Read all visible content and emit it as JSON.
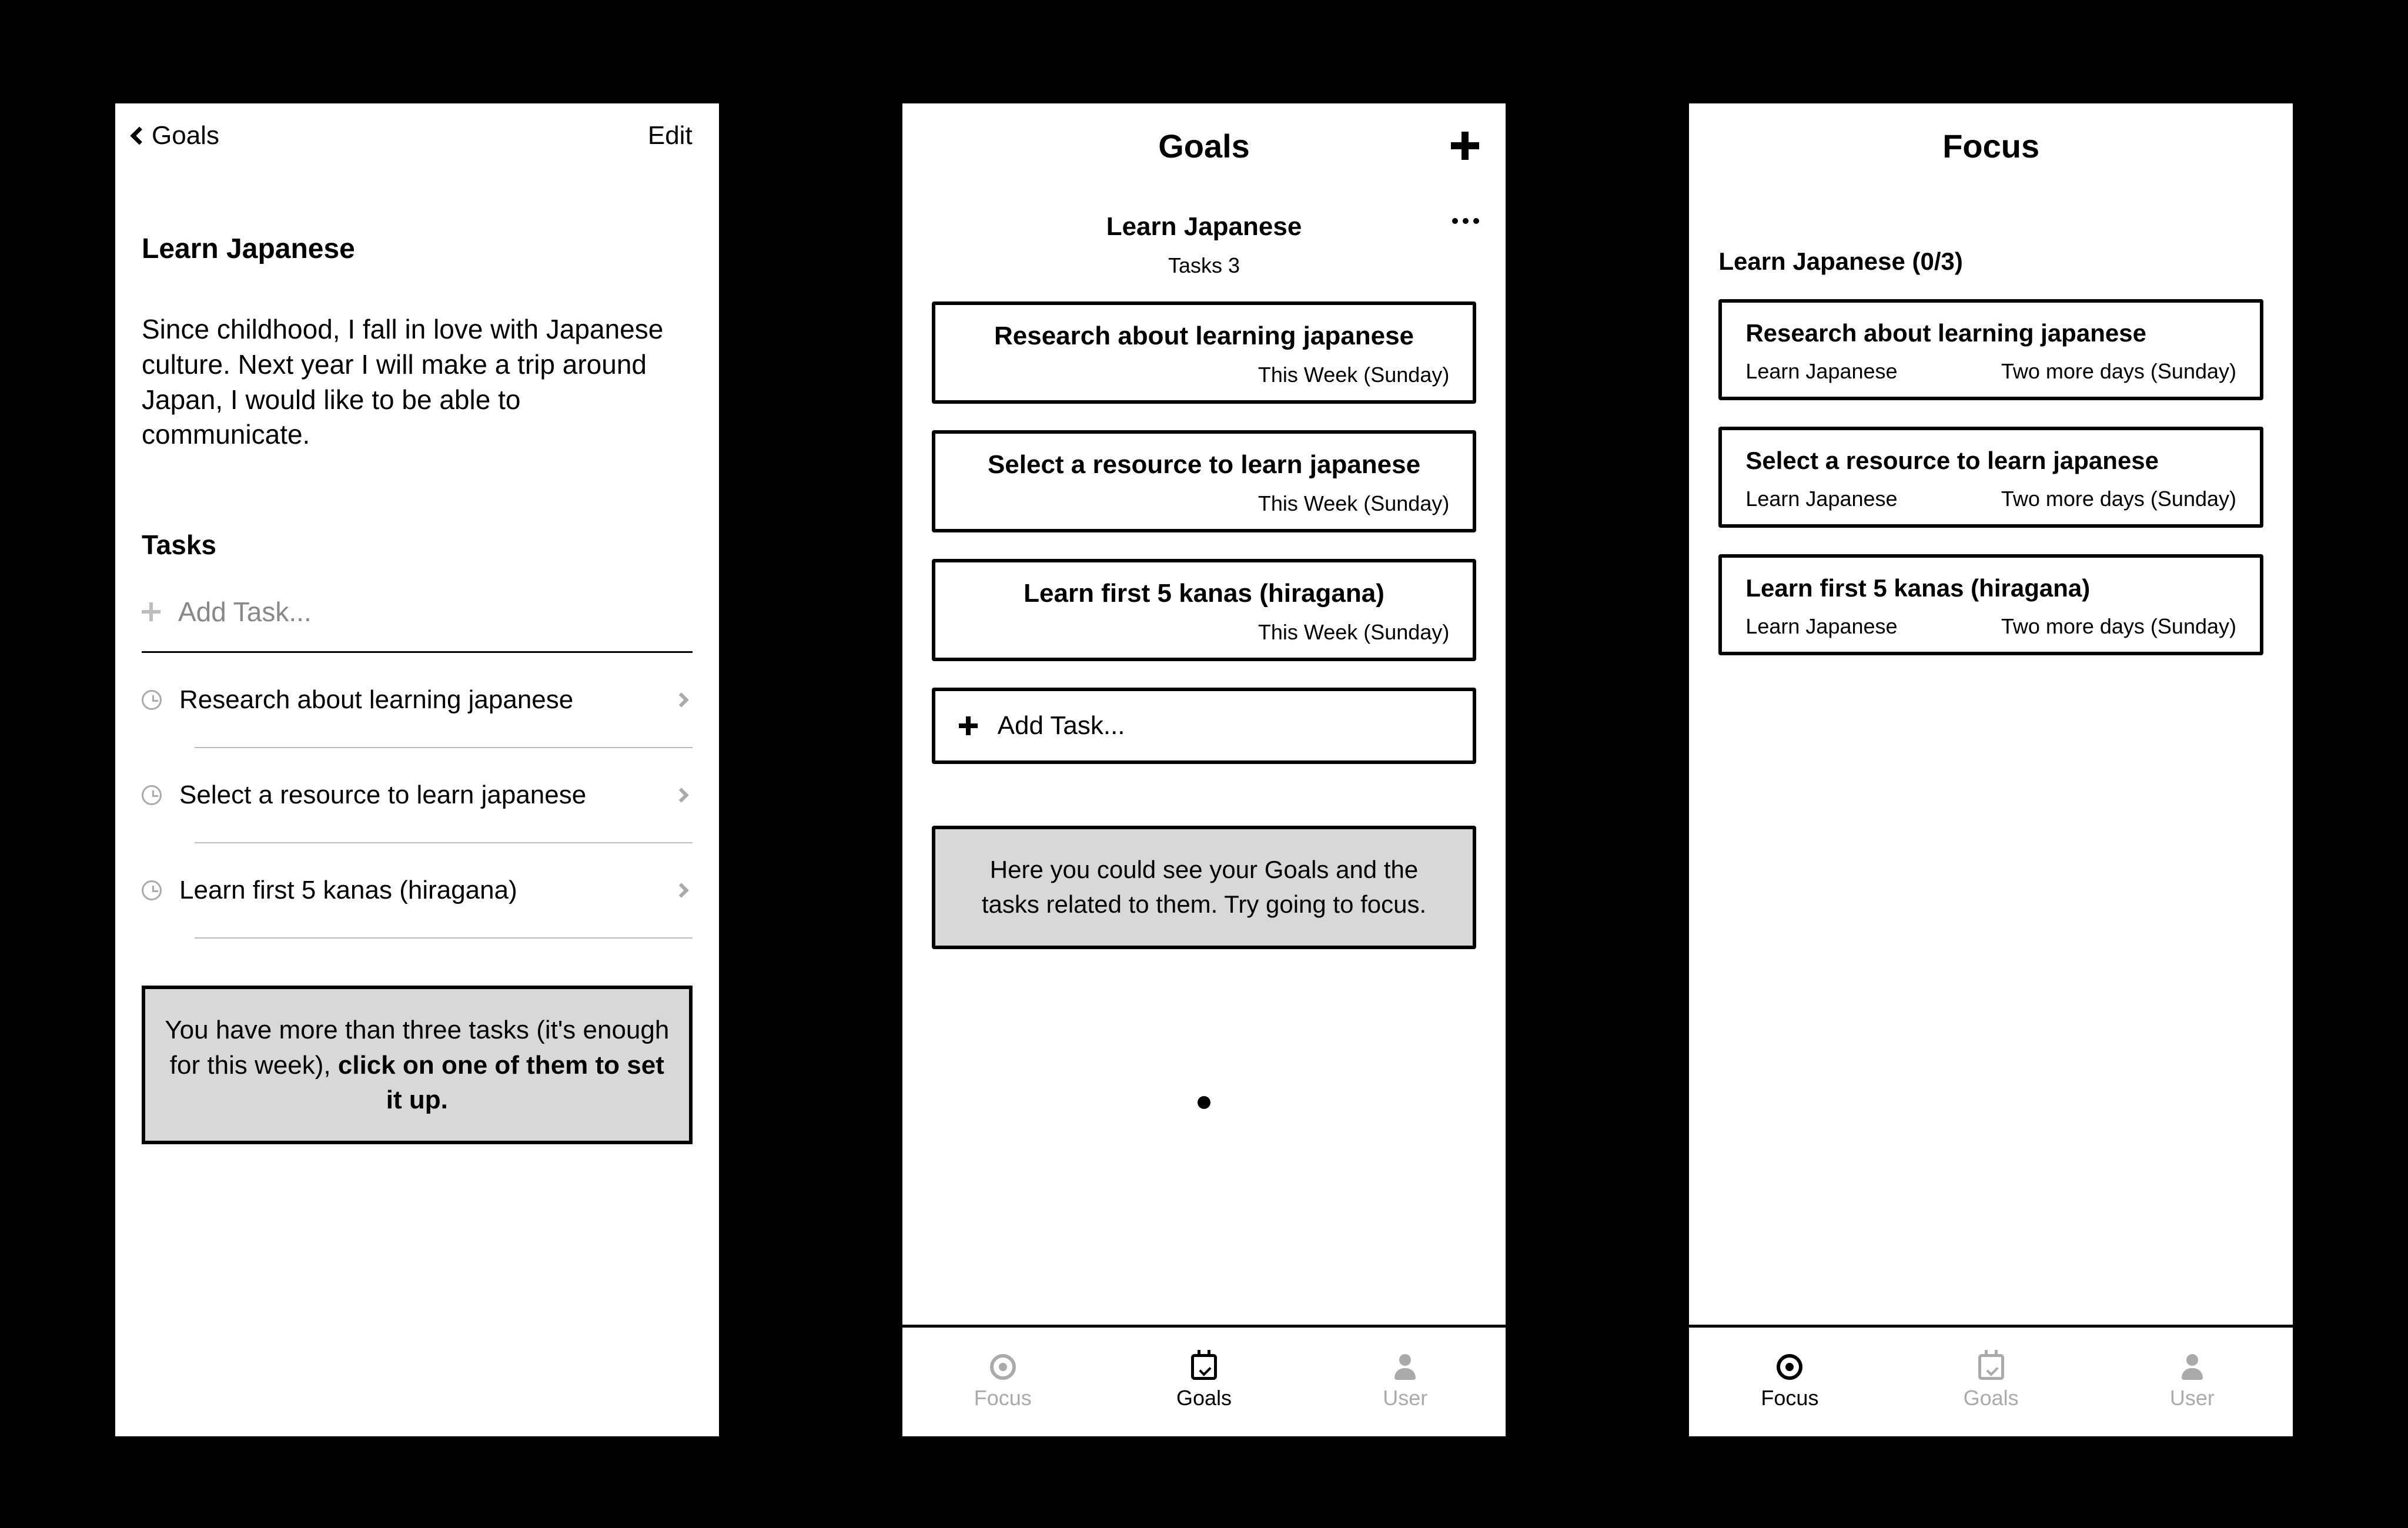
{
  "screen1": {
    "back_label": "Goals",
    "edit_label": "Edit",
    "goal_title": "Learn Japanese",
    "goal_description": "Since childhood, I fall in love with Japanese culture. Next year I will make a trip around Japan, I would like to be able to communicate.",
    "tasks_heading": "Tasks",
    "add_task_placeholder": "Add Task...",
    "tasks": [
      {
        "label": "Research about learning japanese"
      },
      {
        "label": "Select a resource to learn japanese"
      },
      {
        "label": "Learn first 5 kanas (hiragana)"
      }
    ],
    "hint_pre": "You have more than three tasks (it's enough for this week), ",
    "hint_bold": "click on one of them to set it up."
  },
  "screen2": {
    "title": "Goals",
    "goal_name": "Learn Japanese",
    "task_count_label": "Tasks 3",
    "tasks": [
      {
        "title": "Research about learning japanese",
        "due": "This Week (Sunday)"
      },
      {
        "title": "Select a resource to learn japanese",
        "due": "This Week (Sunday)"
      },
      {
        "title": "Learn first 5 kanas (hiragana)",
        "due": "This Week (Sunday)"
      }
    ],
    "add_task_label": "Add Task...",
    "tip": "Here you could see your Goals and the tasks related to them. Try going to focus.",
    "tabs": {
      "focus": "Focus",
      "goals": "Goals",
      "user": "User"
    }
  },
  "screen3": {
    "title": "Focus",
    "goal_progress": "Learn Japanese (0/3)",
    "tasks": [
      {
        "title": "Research about learning japanese",
        "goal": "Learn Japanese",
        "due": "Two more days (Sunday)"
      },
      {
        "title": "Select a resource to learn japanese",
        "goal": "Learn Japanese",
        "due": "Two more days (Sunday)"
      },
      {
        "title": "Learn first 5 kanas (hiragana)",
        "goal": "Learn Japanese",
        "due": "Two more days (Sunday)"
      }
    ],
    "tabs": {
      "focus": "Focus",
      "goals": "Goals",
      "user": "User"
    }
  }
}
